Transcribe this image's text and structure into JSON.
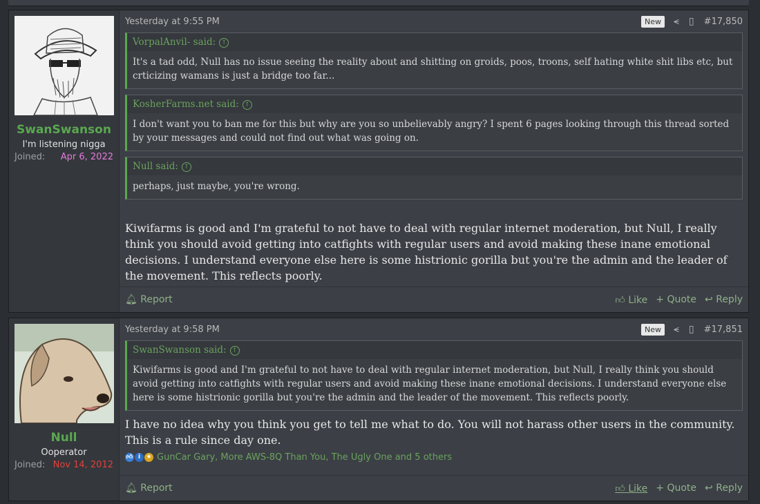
{
  "posts": [
    {
      "user": {
        "name": "SwanSwanson",
        "title": "I'm listening nigga",
        "joined_label": "Joined:",
        "joined_date": "Apr 6, 2022",
        "joined_color": "#e67bdc"
      },
      "date": "Yesterday at 9:55 PM",
      "badge": "New",
      "number": "#17,850",
      "quotes": [
        {
          "author": "VorpalAnvil- said:",
          "text": "It's a tad odd, Null has no issue seeing the reality about and shitting on groids, poos, troons, self hating white shit libs etc, but crticizing wamans is just a bridge too far..."
        },
        {
          "author": "KosherFarms.net said:",
          "text": "I don't want you to ban me for this but why are you so unbelievably angry? I spent 6 pages looking through this thread sorted by your messages and could not find out what was going on."
        },
        {
          "author": "Null said:",
          "text": "perhaps, just maybe, you're wrong."
        }
      ],
      "body": "Kiwifarms is good and I'm grateful to not have to deal with regular internet moderation, but Null, I really think you should avoid getting into catfights with regular users and avoid making these inane emotional decisions. I understand everyone else here is some histrionic gorilla but you're the admin and the leader of the movement. This reflects poorly.",
      "footer": {
        "report": "Report",
        "like": "Like",
        "quote": "Quote",
        "reply": "Reply"
      }
    },
    {
      "user": {
        "name": "Null",
        "title": "Ooperator",
        "joined_label": "Joined:",
        "joined_date": "Nov 14, 2012",
        "joined_color": "#e0413b"
      },
      "date": "Yesterday at 9:58 PM",
      "badge": "New",
      "number": "#17,851",
      "quotes": [
        {
          "author": "SwanSwanson said:",
          "text": "Kiwifarms is good and I'm grateful to not have to deal with regular internet moderation, but Null, I really think you should avoid getting into catfights with regular users and avoid making these inane emotional decisions. I understand everyone else here is some histrionic gorilla but you're the admin and the leader of the movement. This reflects poorly."
        }
      ],
      "body": "I have no idea why you think you get to tell me what to do. You will not harass other users in the community. This is a rule since day one.",
      "reactions": "GunCar Gary, More AWS-8Q Than You, The Ugly One and 5 others",
      "footer": {
        "report": "Report",
        "like": "Like",
        "quote": "Quote",
        "reply": "Reply"
      }
    }
  ],
  "icons": [
    "share-icon",
    "bookmark-icon",
    "bell-icon",
    "thumbs-up-icon",
    "plus-icon",
    "reply-icon",
    "arrow-up-circle-icon"
  ]
}
